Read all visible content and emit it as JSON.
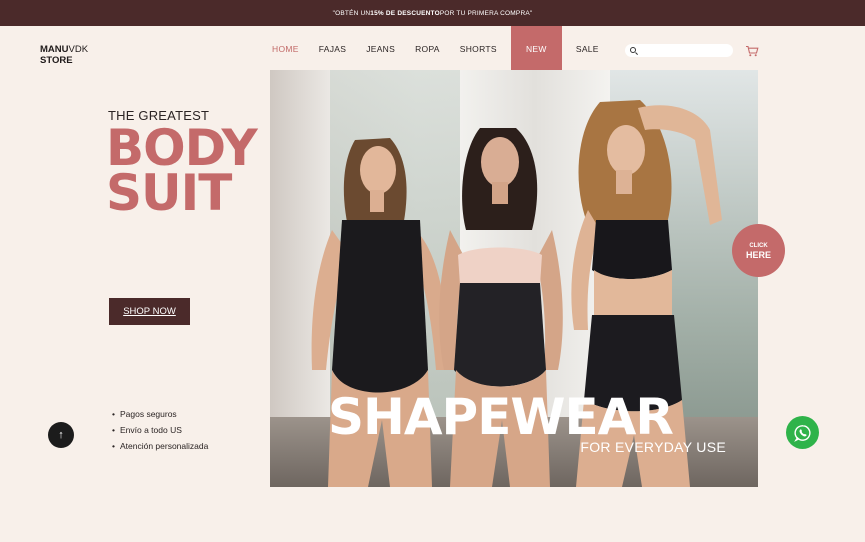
{
  "promo": {
    "prefix": "\"OBTÉN UN ",
    "highlight": "15% DE DESCUENTO",
    "suffix": " POR TU PRIMERA COMPRA\""
  },
  "logo": {
    "brand": "MANU",
    "brand_suffix": "VDK",
    "line2": "STORE"
  },
  "nav": [
    {
      "label": "HOME"
    },
    {
      "label": "FAJAS"
    },
    {
      "label": "JEANS"
    },
    {
      "label": "ROPA"
    },
    {
      "label": "SHORTS"
    },
    {
      "label": "NEW"
    },
    {
      "label": "SALE"
    }
  ],
  "search": {
    "placeholder": "",
    "icon": "search-icon"
  },
  "cart": {
    "icon": "cart-icon"
  },
  "hero_text": {
    "kicker": "THE GREATEST",
    "line1": "BODY",
    "line2": "SUIT",
    "cta": "SHOP NOW"
  },
  "features": [
    "Pagos seguros",
    "Envío a todo US",
    "Atención personalizada"
  ],
  "scroll_top": {
    "symbol": "↑"
  },
  "banner": {
    "title": "SHAPEWEAR",
    "subtitle": "FOR EVERYDAY USE"
  },
  "click_badge": {
    "line1": "CLICK",
    "line2": "HERE"
  },
  "whatsapp": {
    "icon": "whatsapp-icon"
  },
  "colors": {
    "accent": "#c46a6a",
    "dark": "#4b2a2a",
    "background": "#f8f0ea",
    "whatsapp": "#2fb34a"
  }
}
